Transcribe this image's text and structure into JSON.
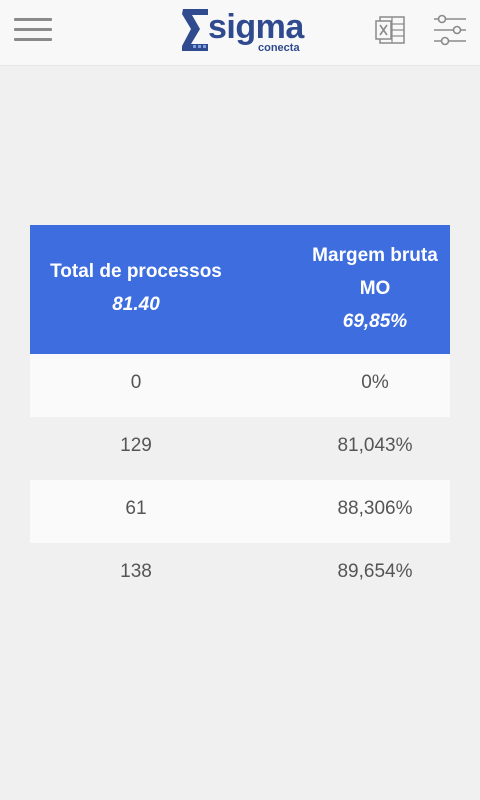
{
  "header": {
    "logo_word": "sigma",
    "logo_sub": "conecta",
    "menu_icon": "hamburger-menu-icon",
    "excel_icon": "excel-export-icon",
    "filter_icon": "filter-sliders-icon"
  },
  "table": {
    "columns": [
      {
        "title": "Total de processos",
        "total": "81.40"
      },
      {
        "title": "Margem bruta MO",
        "total": "69,85%"
      }
    ],
    "rows": [
      {
        "processos": "0",
        "margem": "0%"
      },
      {
        "processos": "129",
        "margem": "81,043%"
      },
      {
        "processos": "61",
        "margem": "88,306%"
      },
      {
        "processos": "138",
        "margem": "89,654%"
      }
    ]
  },
  "colors": {
    "header_bg": "#3e6de0",
    "logo": "#2f4a8e",
    "background": "#f0f0f0"
  }
}
